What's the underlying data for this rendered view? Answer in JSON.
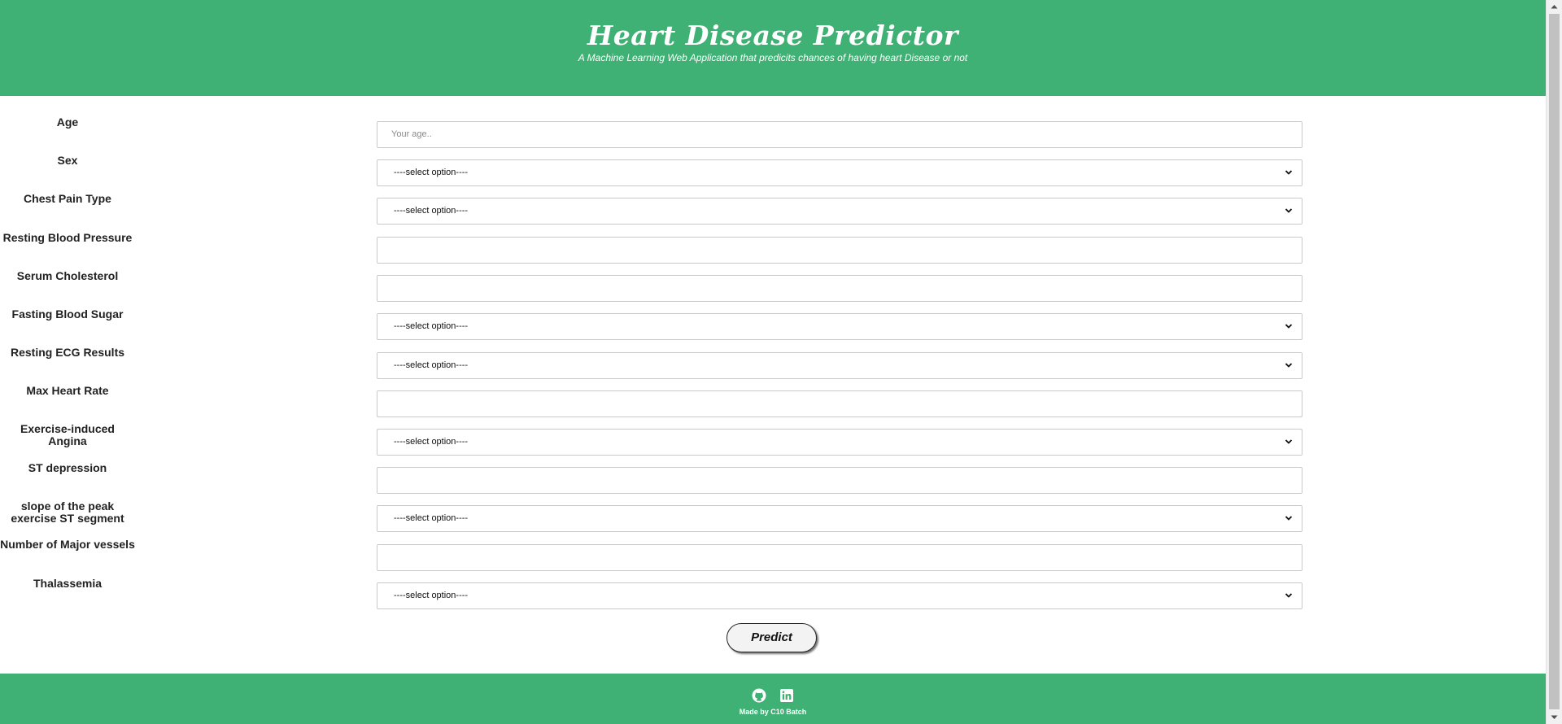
{
  "header": {
    "title": "Heart Disease Predictor",
    "subtitle": "A Machine Learning Web Application that predicits chances of having heart Disease or not"
  },
  "form": {
    "fields": [
      {
        "label": "Age",
        "type": "input",
        "placeholder": "Your age..",
        "value": ""
      },
      {
        "label": "Sex",
        "type": "select",
        "value": "----select option----"
      },
      {
        "label": "Chest Pain Type",
        "type": "select",
        "value": "----select option----"
      },
      {
        "label": "Resting Blood Pressure",
        "type": "input",
        "placeholder": "",
        "value": ""
      },
      {
        "label": "Serum Cholesterol",
        "type": "input",
        "placeholder": "",
        "value": ""
      },
      {
        "label": "Fasting Blood Sugar",
        "type": "select",
        "value": "----select option----"
      },
      {
        "label": "Resting ECG Results",
        "type": "select",
        "value": "----select option----"
      },
      {
        "label": "Max Heart Rate",
        "type": "input",
        "placeholder": "",
        "value": ""
      },
      {
        "label": "Exercise-induced Angina",
        "type": "select",
        "value": "----select option----"
      },
      {
        "label": "ST depression",
        "type": "input",
        "placeholder": "",
        "value": ""
      },
      {
        "label": "slope of the peak exercise ST segment",
        "type": "select",
        "value": "----select option----"
      },
      {
        "label": "Number of Major vessels",
        "type": "input",
        "placeholder": "",
        "value": ""
      },
      {
        "label": "Thalassemia",
        "type": "select",
        "value": "----select option----"
      }
    ],
    "submit_label": "Predict"
  },
  "footer": {
    "icons": [
      "github-icon",
      "linkedin-icon"
    ],
    "credit": "Made by C10 Batch"
  },
  "colors": {
    "brand_green": "#3fb174",
    "background": "#ffffff",
    "field_border": "#c9c9c9"
  }
}
